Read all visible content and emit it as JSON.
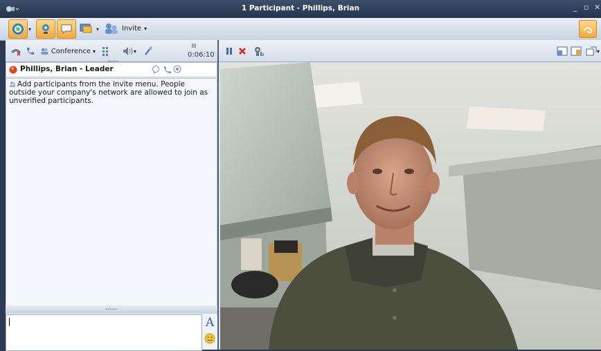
{
  "window": {
    "title": "1 Participant - Phillips, Brian",
    "minimize": "_",
    "restore": "▫",
    "close": "✕"
  },
  "toolbar": {
    "invite_label": "Invite",
    "conference_label": "Conference",
    "timer_bars": "IIIII",
    "timer": "0:06:10"
  },
  "participant": {
    "name": "Phillips, Brian - Leader"
  },
  "info": {
    "message": "Add participants from the invite menu. People outside your company's network are allowed to join as unverified participants."
  },
  "compose": {
    "font_glyph": "A"
  },
  "colors": {
    "accent": "#f4a93a",
    "title_bar": "#24344e",
    "status_red": "#e0421c"
  }
}
